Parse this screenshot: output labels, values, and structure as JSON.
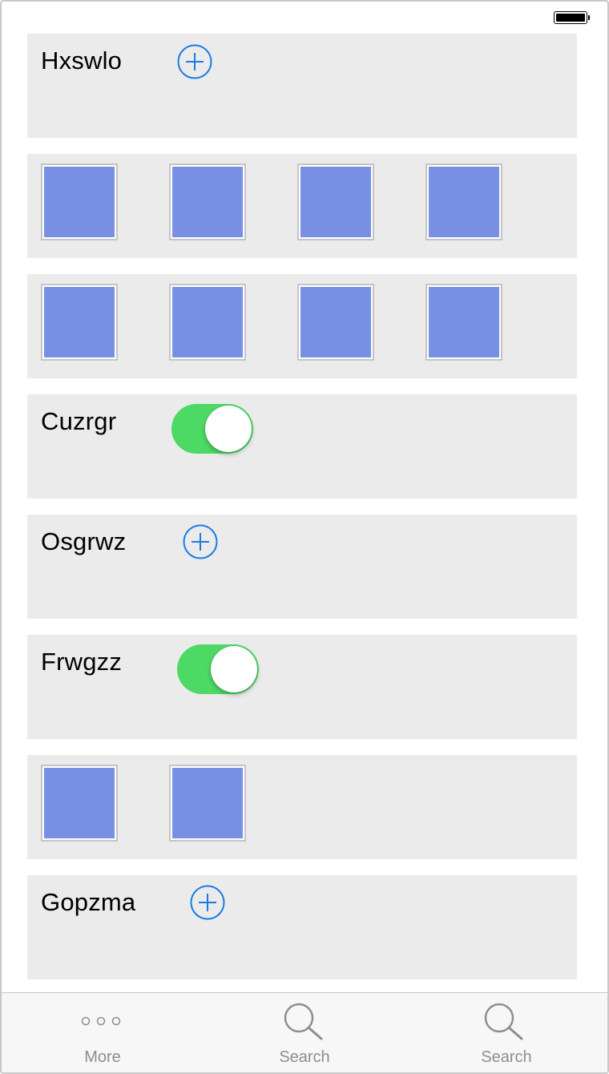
{
  "status_bar": {
    "battery_icon": "battery-full-icon"
  },
  "rows": {
    "hxswlo": {
      "label": "Hxswlo",
      "icon": "add-circle-icon"
    },
    "cuzrgr": {
      "label": "Cuzrgr",
      "toggle_on": true
    },
    "osgrwz": {
      "label": "Osgrwz",
      "icon": "add-circle-icon"
    },
    "frwgzz": {
      "label": "Frwgzz",
      "toggle_on": true
    },
    "gopzma": {
      "label": "Gopzma",
      "icon": "add-circle-icon"
    }
  },
  "image_grids": {
    "grid_1_count": 4,
    "grid_2_count": 4,
    "grid_3_count": 2
  },
  "tab_bar": {
    "tabs": [
      {
        "label": "More",
        "icon": "more-dots-icon"
      },
      {
        "label": "Search",
        "icon": "search-icon"
      },
      {
        "label": "Search",
        "icon": "search-icon"
      }
    ]
  },
  "colors": {
    "row_background": "#ebebeb",
    "accent_blue": "#1a7be6",
    "toggle_green": "#4cd964",
    "thumbnail_fill": "#7790e4",
    "tab_inactive": "#8e8e8e"
  }
}
